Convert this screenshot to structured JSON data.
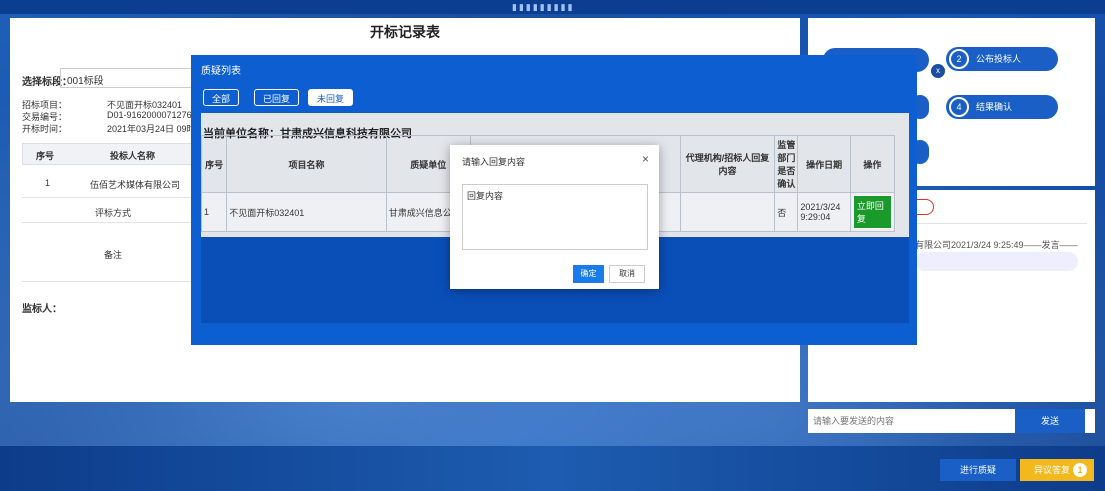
{
  "window": {
    "title": "开标记录表"
  },
  "left": {
    "bid_label": "选择标段：",
    "bid_value": "001标段",
    "project_label": "招标项目：",
    "project_value": "不见面开标032401",
    "trade_label": "交易编号：",
    "trade_value": "D01-91620000712760",
    "open_label": "开标时间：",
    "open_value": "2021年03月24日 09时",
    "col_seq": "序号",
    "col_name": "投标人名称",
    "row1_seq": "1",
    "row1_name": "伍佰艺术媒体有限公司",
    "eval_label": "评标方式",
    "remark_label": "备注",
    "monitor_label": "监标人："
  },
  "steps": [
    {
      "num": "2",
      "label": "公布投标人"
    },
    {
      "num": "4",
      "label": "结果确认"
    }
  ],
  "step_close": "x",
  "modal": {
    "title": "质疑列表",
    "tabs": [
      "全部",
      "已回复",
      "未回复"
    ],
    "unit_line": "当前单位名称：甘肃成兴信息科技有限公司",
    "headers": [
      "序号",
      "项目名称",
      "质疑单位",
      "代理机构/招标人回复内容",
      "监管部门是否确认",
      "操作日期",
      "操作"
    ],
    "row": {
      "seq": "1",
      "project": "不见面开标032401",
      "unit": "甘肃成兴信息公司",
      "confirm": "否",
      "date": "2021/3/24 9:29:04",
      "action": "立即回复"
    }
  },
  "dialog": {
    "title": "请输入回复内容",
    "close": "×",
    "text": "回复内容",
    "ok": "确定",
    "cancel": "取消"
  },
  "chat": {
    "pill": "码",
    "message": "有限公司2021/3/24 9:25:49——发言——",
    "input_placeholder": "请输入要发送的内容",
    "send": "发送"
  },
  "bottom": {
    "question": "进行质疑",
    "objection": "异议答复",
    "badge": "1"
  }
}
